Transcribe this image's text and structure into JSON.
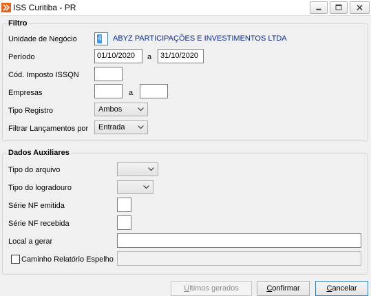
{
  "window": {
    "title": "ISS Curitiba - PR"
  },
  "filtro": {
    "legend": "Filtro",
    "unidade_label": "Unidade de Negócio",
    "unidade_code": "4",
    "unidade_name": "ABYZ PARTICIPAÇÕES E INVESTIMENTOS LTDA",
    "periodo_label": "Período",
    "periodo_start": "01/10/2020",
    "periodo_sep": "a",
    "periodo_end": "31/10/2020",
    "cod_imposto_label": "Cód. Imposto ISSQN",
    "cod_imposto_value": "",
    "empresas_label": "Empresas",
    "empresas_start": "",
    "empresas_sep": "a",
    "empresas_end": "",
    "tipo_registro_label": "Tipo Registro",
    "tipo_registro_value": "Ambos",
    "filtrar_label": "Filtrar Lançamentos por",
    "filtrar_value": "Entrada"
  },
  "aux": {
    "legend": "Dados Auxiliares",
    "tipo_arquivo_label": "Tipo do arquivo",
    "tipo_arquivo_value": "",
    "tipo_logradouro_label": "Tipo do logradouro",
    "tipo_logradouro_value": "",
    "serie_emitida_label": "Série NF emitida",
    "serie_emitida_value": "",
    "serie_recebida_label": "Série NF recebida",
    "serie_recebida_value": "",
    "local_gerar_label": "Local a gerar",
    "local_gerar_value": "",
    "caminho_label": "Caminho Relatório Espelho",
    "caminho_checked": false,
    "caminho_value": ""
  },
  "buttons": {
    "ultimos_mn": "Ú",
    "ultimos_rest": "ltimos gerados",
    "confirmar_mn": "C",
    "confirmar_rest": "onfirmar",
    "cancelar_mn": "C",
    "cancelar_rest": "ancelar"
  },
  "colors": {
    "accent": "#3399ff",
    "company_text": "#0b2a8a",
    "app_icon": "#e8621a"
  },
  "icons": {
    "app": "app-logo-icon",
    "minimize": "minimize-icon",
    "maximize": "maximize-icon",
    "close": "close-icon",
    "dropdown": "chevron-down-icon"
  }
}
